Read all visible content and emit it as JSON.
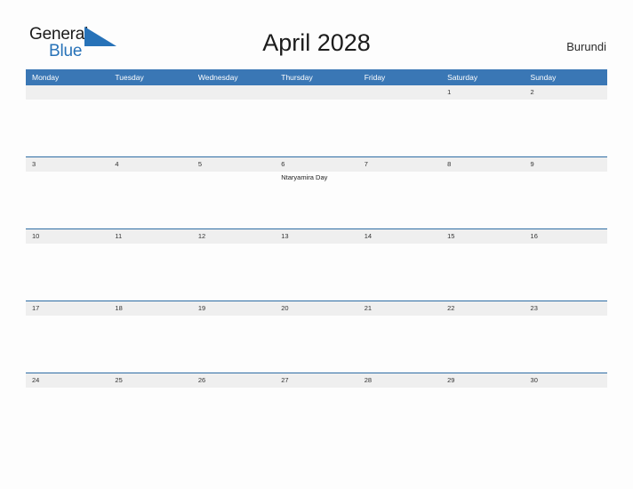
{
  "brand": {
    "name_part1": "General",
    "name_part2": "Blue",
    "triangle_icon": "triangle-icon",
    "color_dark": "#1a1a1a",
    "color_blue": "#2772b8"
  },
  "header": {
    "title": "April 2028",
    "country": "Burundi"
  },
  "theme": {
    "header_blue": "#3a77b5",
    "row_divider_blue": "#2e6da4",
    "day_band_gray": "#efefef",
    "cell_white": "#fdfdfd",
    "page_background": "#fdfdfd"
  },
  "calendar": {
    "day_headers": [
      "Monday",
      "Tuesday",
      "Wednesday",
      "Thursday",
      "Friday",
      "Saturday",
      "Sunday"
    ],
    "weeks": [
      [
        {
          "day": ""
        },
        {
          "day": ""
        },
        {
          "day": ""
        },
        {
          "day": ""
        },
        {
          "day": ""
        },
        {
          "day": "1"
        },
        {
          "day": "2"
        }
      ],
      [
        {
          "day": "3"
        },
        {
          "day": "4"
        },
        {
          "day": "5"
        },
        {
          "day": "6",
          "events": [
            "Ntaryamira Day"
          ]
        },
        {
          "day": "7"
        },
        {
          "day": "8"
        },
        {
          "day": "9"
        }
      ],
      [
        {
          "day": "10"
        },
        {
          "day": "11"
        },
        {
          "day": "12"
        },
        {
          "day": "13"
        },
        {
          "day": "14"
        },
        {
          "day": "15"
        },
        {
          "day": "16"
        }
      ],
      [
        {
          "day": "17"
        },
        {
          "day": "18"
        },
        {
          "day": "19"
        },
        {
          "day": "20"
        },
        {
          "day": "21"
        },
        {
          "day": "22"
        },
        {
          "day": "23"
        }
      ],
      [
        {
          "day": "24"
        },
        {
          "day": "25"
        },
        {
          "day": "26"
        },
        {
          "day": "27"
        },
        {
          "day": "28"
        },
        {
          "day": "29"
        },
        {
          "day": "30"
        }
      ]
    ]
  }
}
